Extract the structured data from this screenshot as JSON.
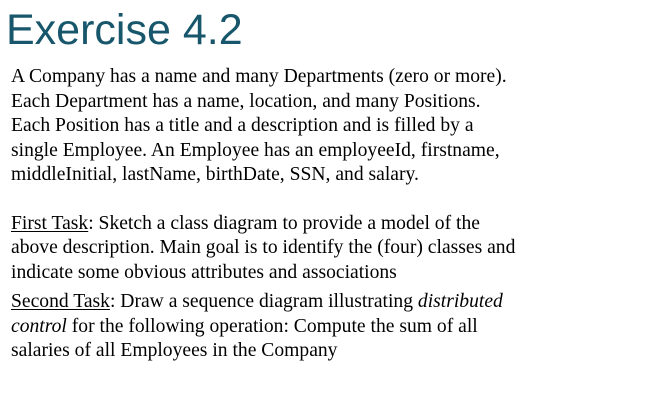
{
  "slide": {
    "title": "Exercise 4.2",
    "description_lines": [
      "A Company has a name and many Departments (zero or more).",
      "Each Department has a name, location, and many Positions.",
      "Each Position has a title and a description and is filled by a",
      "single Employee. An Employee has an employeeId, firstname,",
      "middleInitial, lastName, birthDate, SSN, and salary."
    ],
    "first_task": {
      "label": "First Task",
      "line1_rest": ": Sketch a class diagram to provide a model of the",
      "lines": [
        "above description. Main goal is to identify the (four) classes and",
        "indicate some obvious attributes and associations"
      ]
    },
    "second_task": {
      "label": "Second Task",
      "line1_rest": ": Draw a sequence diagram illustrating ",
      "line1_italic": "distributed",
      "line2_italic": "control",
      "line2_rest": " for the following operation: Compute the sum of all",
      "lines": [
        "salaries of all Employees in the Company"
      ]
    }
  }
}
